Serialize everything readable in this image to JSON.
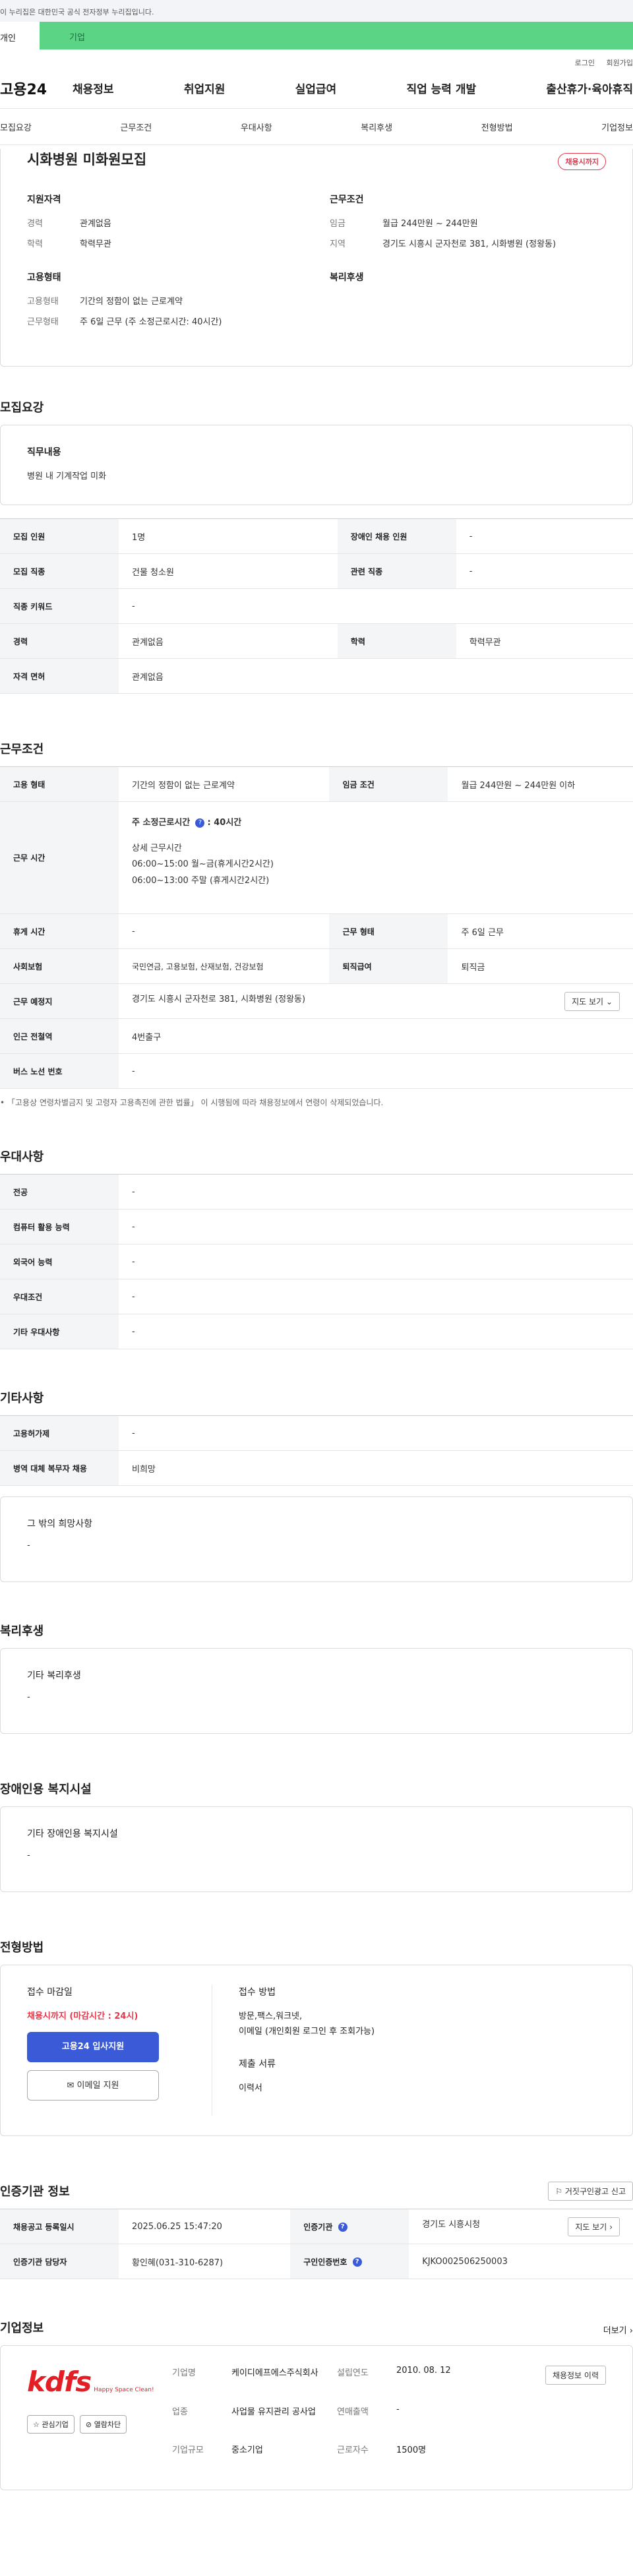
{
  "gov_banner": "이 누리집은 대한민국 공식 전자정부 누리집입니다.",
  "audience": {
    "personal": "개인",
    "corporate": "기업"
  },
  "util_links": [
    "로그인",
    "회원가입"
  ],
  "logo": "고용24",
  "gnb": [
    "채용정보",
    "취업지원",
    "실업급여",
    "직업 능력 개발",
    "출산휴가·육아휴직"
  ],
  "subnav": [
    "모집요강",
    "근무조건",
    "우대사항",
    "복리후생",
    "전형방법",
    "기업정보"
  ],
  "job": {
    "title": "시화병원 미화원모집",
    "badge": "채용시까지",
    "req_title": "지원자격",
    "career_k": "경력",
    "career_v": "관계없음",
    "edu_k": "학력",
    "edu_v": "학력무관",
    "emp_title": "고용형태",
    "emp_type_k": "고용형태",
    "emp_type_v": "기간의 정함이 없는 근로계약",
    "work_form_k": "근무형태",
    "work_form_v": "주 6일 근무 (주 소정근로시간: 40시간)",
    "cond_title": "근무조건",
    "wage_k": "임금",
    "wage_v": "월급 244만원 ~ 244만원",
    "area_k": "지역",
    "area_v": "경기도 시흥시 군자천로 381, 시화병원 (정왕동)",
    "welfare_title": "복리후생"
  },
  "recruit": {
    "title": "모집요강",
    "duty_label": "직무내용",
    "duty_value": "병원 내 기계작업 미화",
    "rows": {
      "count_k": "모집 인원",
      "count_v": "1명",
      "disabled_k": "장애인 채용 인원",
      "disabled_v": "-",
      "job_k": "모집 직종",
      "job_v": "건물 청소원",
      "related_k": "관련 직종",
      "related_v": "-",
      "keyword_k": "직종 키워드",
      "keyword_v": "-",
      "career_k": "경력",
      "career_v": "관계없음",
      "edu_k": "학력",
      "edu_v": "학력무관",
      "license_k": "자격 면허",
      "license_v": "관계없음"
    }
  },
  "conditions": {
    "title": "근무조건",
    "emp_k": "고용 형태",
    "emp_v": "기간의 정함이 없는 근로계약",
    "wage_k": "임금 조건",
    "wage_v": "월급 244만원 ~ 244만원 이하",
    "hours_k": "근무 시간",
    "hours_std": "주 소정근로시간",
    "hours_std_v": ": 40시간",
    "hours_detail_title": "상세 근무시간",
    "hours_line1": "06:00~15:00 월~금(휴게시간2시간)",
    "hours_line2": "06:00~13:00 주말 (휴게시간2시간)",
    "rest_k": "휴게 시간",
    "rest_v": "-",
    "form_k": "근무 형태",
    "form_v": "주 6일 근무",
    "insurance_k": "사회보험",
    "insurance_v": "국민연금, 고용보험, 산재보험, 건강보험",
    "severance_k": "퇴직급여",
    "severance_v": "퇴직금",
    "place_k": "근무 예정지",
    "place_v": "경기도 시흥시 군자천로 381, 시화병원 (정왕동)",
    "map_btn": "지도 보기",
    "subway_k": "인근 전철역",
    "subway_v": "4번출구",
    "bus_k": "버스 노선 번호",
    "bus_v": "-",
    "note": "「고용상 연령차별금지 및 고령자 고용촉진에 관한 법률」 이 시행됨에 따라 채용정보에서 연령이 삭제되었습니다."
  },
  "preference": {
    "title": "우대사항",
    "major_k": "전공",
    "major_v": "-",
    "pc_k": "컴퓨터 활용 능력",
    "pc_v": "-",
    "lang_k": "외국어 능력",
    "lang_v": "-",
    "cond_k": "우대조건",
    "cond_v": "-",
    "etc_k": "기타 우대사항",
    "etc_v": "-"
  },
  "misc": {
    "title": "기타사항",
    "foreign_k": "고용허가제",
    "foreign_v": "-",
    "military_k": "병역 대체 복무자 채용",
    "military_v": "비희망",
    "other_label": "그 밖의 희망사항",
    "other_value": "-"
  },
  "welfare": {
    "title": "복리후생",
    "label": "기타 복리후생",
    "value": "-"
  },
  "facility": {
    "title": "장애인용 복지시설",
    "label": "기타 장애인용 복지시설",
    "value": "-"
  },
  "selection": {
    "title": "전형방법",
    "deadline_label": "접수 마감일",
    "deadline_value": "채용시까지 (마감시간 : 24시)",
    "apply_btn": "고용24 입사지원",
    "email_btn": "이메일 지원",
    "method_label": "접수 방법",
    "method_line1": "방문,팩스,워크넷,",
    "method_line2": "이메일 (개인회원 로그인 후 조회가능)",
    "docs_label": "제출 서류",
    "docs_value": "이력서"
  },
  "agency": {
    "title": "인증기관 정보",
    "report_btn": "거짓구인광고 신고",
    "reg_k": "채용공고 등록일시",
    "reg_v": "2025.06.25 15:47:20",
    "org_k": "인증기관",
    "org_v": "경기도 시흥시청",
    "map_btn": "지도 보기",
    "manager_k": "인증기관 담당자",
    "manager_v": "황인혜(031-310-6287)",
    "id_k": "구인인증번호",
    "id_v": "KJKO002506250003"
  },
  "company": {
    "title": "기업정보",
    "more": "더보기",
    "logo_text": "kdfs",
    "logo_sub": "Happy Space Clean!",
    "interest_btn": "관심기업",
    "block_btn": "열람차단",
    "name_k": "기업명",
    "name_v": "케이디에프에스주식회사",
    "industry_k": "업종",
    "industry_v": "사업물 유지관리 공사업",
    "size_k": "기업규모",
    "size_v": "중소기업",
    "founded_k": "설립연도",
    "founded_v": "2010. 08. 12",
    "sales_k": "연매출액",
    "sales_v": "-",
    "employees_k": "근로자수",
    "employees_v": "1500명",
    "history_btn": "채용정보 이력"
  }
}
